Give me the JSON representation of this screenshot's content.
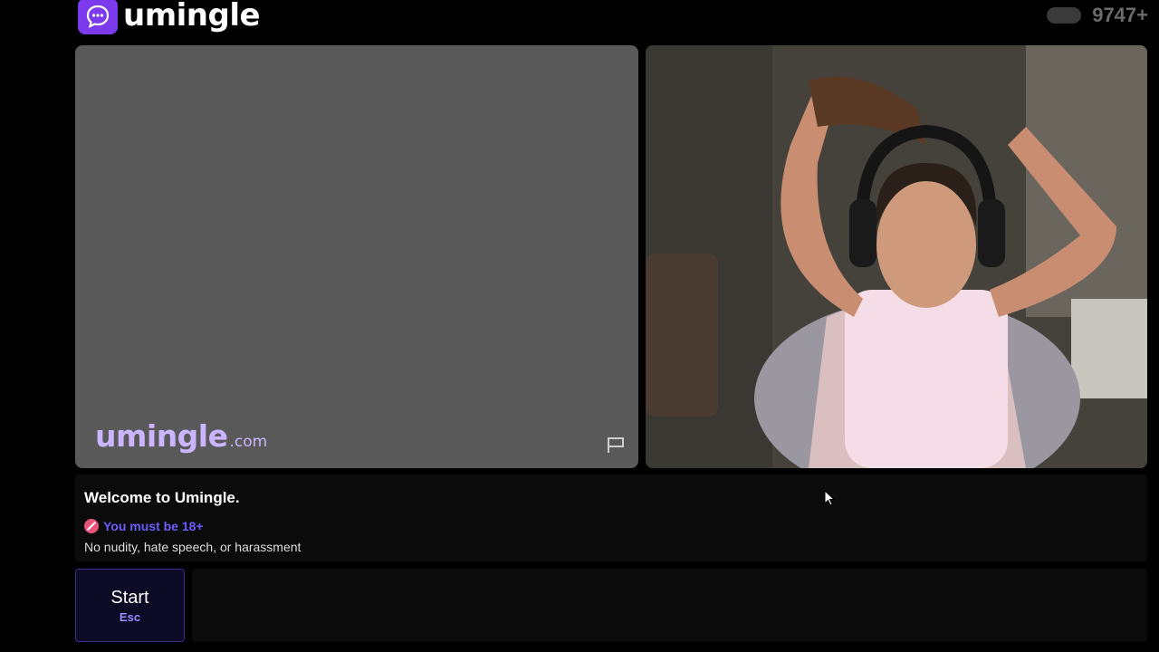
{
  "header": {
    "logo_text": "umingle",
    "online_count": "9747+"
  },
  "video_left": {
    "watermark_main": "umingle",
    "watermark_suffix": ".com",
    "icon": "flag-icon"
  },
  "video_right": {
    "icon": "remote-video-feed"
  },
  "info": {
    "welcome": "Welcome to Umingle.",
    "age_notice": "You must be 18+",
    "rules": "No nudity, hate speech, or harassment"
  },
  "controls": {
    "start_label": "Start",
    "start_key": "Esc"
  },
  "colors": {
    "accent": "#7c3aed",
    "age_text": "#6d5bff"
  }
}
